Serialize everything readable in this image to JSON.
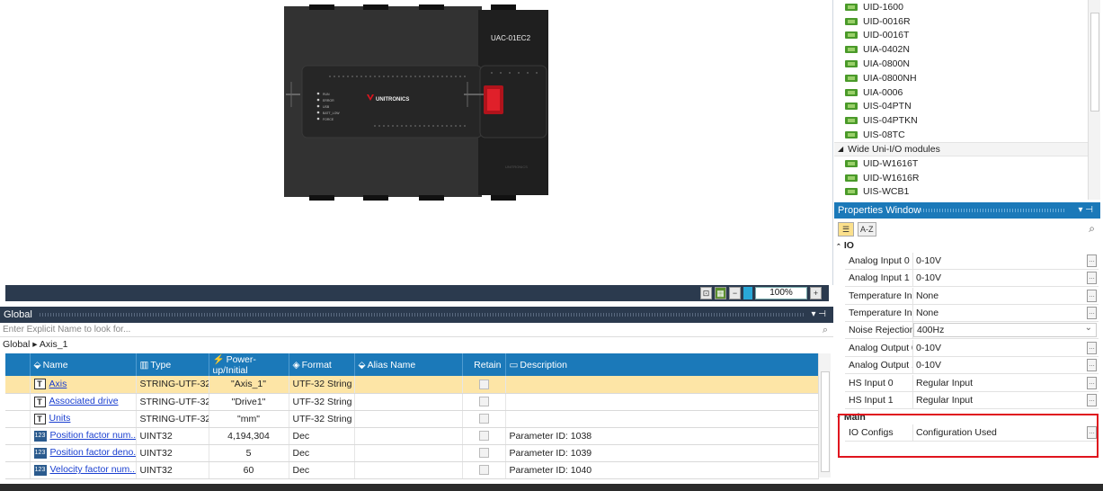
{
  "canvas": {
    "device_label": "UAC-01EC2",
    "brand": "UNITRONICS",
    "led_labels": [
      "RUN",
      "ERROR",
      "USB",
      "BATT_LOW",
      "FORCE"
    ],
    "zoom": "100%"
  },
  "global_panel": {
    "title": "Global",
    "search_placeholder": "Enter Explicit Name to look for...",
    "breadcrumb_root": "Global",
    "breadcrumb_sep": "▸",
    "breadcrumb_leaf": "Axis_1",
    "columns": [
      "Name",
      "Type",
      "Power-up/Initial",
      "Format",
      "Alias Name",
      "Retain",
      "Description"
    ],
    "rows": [
      {
        "icon": "text-icon",
        "name": "Axis",
        "type": "STRING-UTF-32",
        "initial": "\"Axis_1\"",
        "format": "UTF-32 String",
        "alias": "",
        "desc": ""
      },
      {
        "icon": "text-icon",
        "name": "Associated drive",
        "type": "STRING-UTF-32",
        "initial": "\"Drive1\"",
        "format": "UTF-32 String",
        "alias": "",
        "desc": ""
      },
      {
        "icon": "text-icon",
        "name": "Units",
        "type": "STRING-UTF-32",
        "initial": "\"mm\"",
        "format": "UTF-32 String",
        "alias": "",
        "desc": ""
      },
      {
        "icon": "number-icon",
        "name": "Position factor num...",
        "type": "UINT32",
        "initial": "4,194,304",
        "format": "Dec",
        "alias": "",
        "desc": "Parameter ID: 1038"
      },
      {
        "icon": "number-icon",
        "name": "Position factor deno...",
        "type": "UINT32",
        "initial": "5",
        "format": "Dec",
        "alias": "",
        "desc": "Parameter ID: 1039"
      },
      {
        "icon": "number-icon",
        "name": "Velocity factor num...",
        "type": "UINT32",
        "initial": "60",
        "format": "Dec",
        "alias": "",
        "desc": "Parameter ID: 1040"
      }
    ]
  },
  "module_list": {
    "items": [
      "UID-1600",
      "UID-0016R",
      "UID-0016T",
      "UIA-0402N",
      "UIA-0800N",
      "UIA-0800NH",
      "UIA-0006",
      "UIS-04PTN",
      "UIS-04PTKN",
      "UIS-08TC"
    ],
    "group": "Wide Uni-I/O modules",
    "group_items": [
      "UID-W1616T",
      "UID-W1616R",
      "UIS-WCB1"
    ]
  },
  "properties": {
    "title": "Properties Window",
    "sort_label": "A-Z",
    "category_io": "IO",
    "rows": [
      {
        "key": "Analog Input 0",
        "value": "0-10V"
      },
      {
        "key": "Analog Input 1",
        "value": "0-10V"
      },
      {
        "key": "Temperature In...",
        "value": "None"
      },
      {
        "key": "Temperature In...",
        "value": "None"
      },
      {
        "key": "Noise Rejection",
        "value": "400Hz"
      },
      {
        "key": "Analog Output 0",
        "value": "0-10V"
      },
      {
        "key": "Analog Output 1",
        "value": "0-10V"
      },
      {
        "key": "HS Input 0",
        "value": "Regular Input"
      },
      {
        "key": "HS Input 1",
        "value": "Regular Input"
      }
    ],
    "category_main": "Main",
    "main_row": {
      "key": "IO Configs",
      "value": "Configuration Used"
    }
  },
  "colors": {
    "header": "#2b3a4e",
    "accent": "#1b79b9",
    "selected_row": "#fde5a6",
    "highlight": "#e0141e"
  }
}
